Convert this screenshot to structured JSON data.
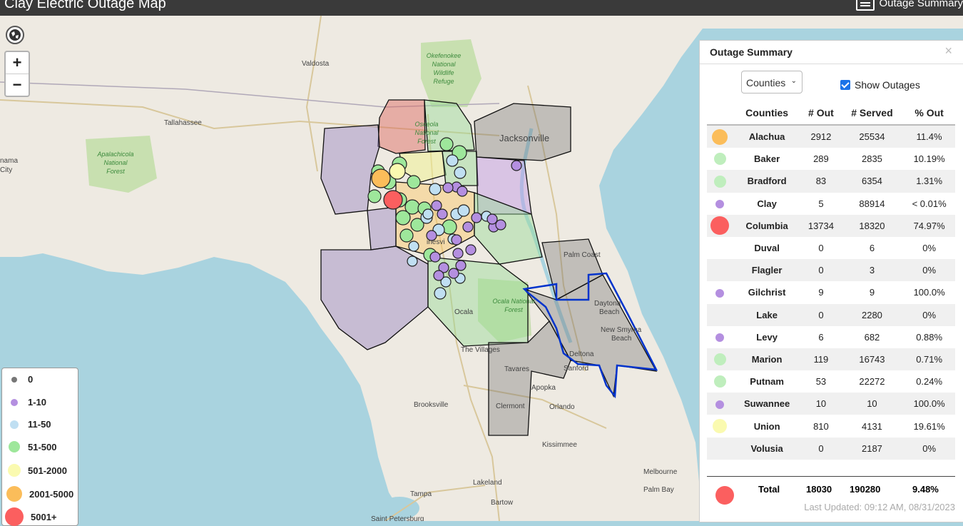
{
  "app": {
    "title": "Clay Electric Outage Map",
    "summary_button": "Outage Summary"
  },
  "map_labels": {
    "okefenokee": [
      "Okefenokee",
      "National",
      "Wildlife",
      "Refuge"
    ],
    "valdosta": "Valdosta",
    "tallahassee": "Tallahassee",
    "apalachicola": [
      "Apalachicola",
      "National",
      "Forest"
    ],
    "osceola": [
      "Osceola",
      "National",
      "Forest"
    ],
    "jacksonville": "Jacksonville",
    "palm_coast": "Palm Coast",
    "daytona": [
      "Daytona",
      "Beach"
    ],
    "new_smyrna": [
      "New Smyrna",
      "Beach"
    ],
    "ocala": "Ocala",
    "ocala_forest": [
      "Ocala National",
      "Forest"
    ],
    "the_villages": "The Villages",
    "deltona": "Deltona",
    "sanford": "Sanford",
    "tavares": "Tavares",
    "apopka": "Apopka",
    "orlando": "Orlando",
    "brooksville": "Brooksville",
    "clermont": "Clermont",
    "kissimmee": "Kissimmee",
    "melbourne": "Melbourne",
    "palm_bay": "Palm Bay",
    "lakeland": "Lakeland",
    "bartow": "Bartow",
    "tampa": "Tampa",
    "gainesville_fragment": "inesvi",
    "panama_fragment": [
      "nama",
      "City"
    ],
    "st_petersburg": "Saint Petersburg"
  },
  "zoom": {
    "in": "+",
    "out": "−"
  },
  "legend": [
    {
      "label": "0",
      "color": "#777777"
    },
    {
      "label": "1-10",
      "color": "#b48fe0"
    },
    {
      "label": "11-50",
      "color": "#c0dff2"
    },
    {
      "label": "51-500",
      "color": "#9ee79b"
    },
    {
      "label": "501-2000",
      "color": "#fafab0"
    },
    {
      "label": "2001-5000",
      "color": "#fbbd5a"
    },
    {
      "label": "5001+",
      "color": "#fb5f5f"
    }
  ],
  "panel": {
    "title": "Outage Summary",
    "close": "×",
    "select_value": "Counties",
    "show_outages": "Show Outages",
    "columns": [
      "Counties",
      "# Out",
      "# Served",
      "% Out"
    ],
    "rows": [
      {
        "county": "Alachua",
        "out": "2912",
        "served": "25534",
        "pct": "11.4%",
        "color": "#fbbd5a",
        "size": 22
      },
      {
        "county": "Baker",
        "out": "289",
        "served": "2835",
        "pct": "10.19%",
        "color": "#bfeebd",
        "size": 17
      },
      {
        "county": "Bradford",
        "out": "83",
        "served": "6354",
        "pct": "1.31%",
        "color": "#bfeebd",
        "size": 17
      },
      {
        "county": "Clay",
        "out": "5",
        "served": "88914",
        "pct": "< 0.01%",
        "color": "#b48fe0",
        "size": 12
      },
      {
        "county": "Columbia",
        "out": "13734",
        "served": "18320",
        "pct": "74.97%",
        "color": "#fb5f5f",
        "size": 26
      },
      {
        "county": "Duval",
        "out": "0",
        "served": "6",
        "pct": "0%",
        "color": "",
        "size": 0
      },
      {
        "county": "Flagler",
        "out": "0",
        "served": "3",
        "pct": "0%",
        "color": "",
        "size": 0
      },
      {
        "county": "Gilchrist",
        "out": "9",
        "served": "9",
        "pct": "100.0%",
        "color": "#b48fe0",
        "size": 12
      },
      {
        "county": "Lake",
        "out": "0",
        "served": "2280",
        "pct": "0%",
        "color": "",
        "size": 0
      },
      {
        "county": "Levy",
        "out": "6",
        "served": "682",
        "pct": "0.88%",
        "color": "#b48fe0",
        "size": 12
      },
      {
        "county": "Marion",
        "out": "119",
        "served": "16743",
        "pct": "0.71%",
        "color": "#bfeebd",
        "size": 17
      },
      {
        "county": "Putnam",
        "out": "53",
        "served": "22272",
        "pct": "0.24%",
        "color": "#bfeebd",
        "size": 17
      },
      {
        "county": "Suwannee",
        "out": "10",
        "served": "10",
        "pct": "100.0%",
        "color": "#b48fe0",
        "size": 12
      },
      {
        "county": "Union",
        "out": "810",
        "served": "4131",
        "pct": "19.61%",
        "color": "#fafab0",
        "size": 20
      },
      {
        "county": "Volusia",
        "out": "0",
        "served": "2187",
        "pct": "0%",
        "color": "",
        "size": 0
      }
    ],
    "total": {
      "label": "Total",
      "out": "18030",
      "served": "190280",
      "pct": "9.48%",
      "color": "#fb5f5f"
    },
    "updated": "Last Updated: 09:12 AM, 08/31/2023"
  }
}
